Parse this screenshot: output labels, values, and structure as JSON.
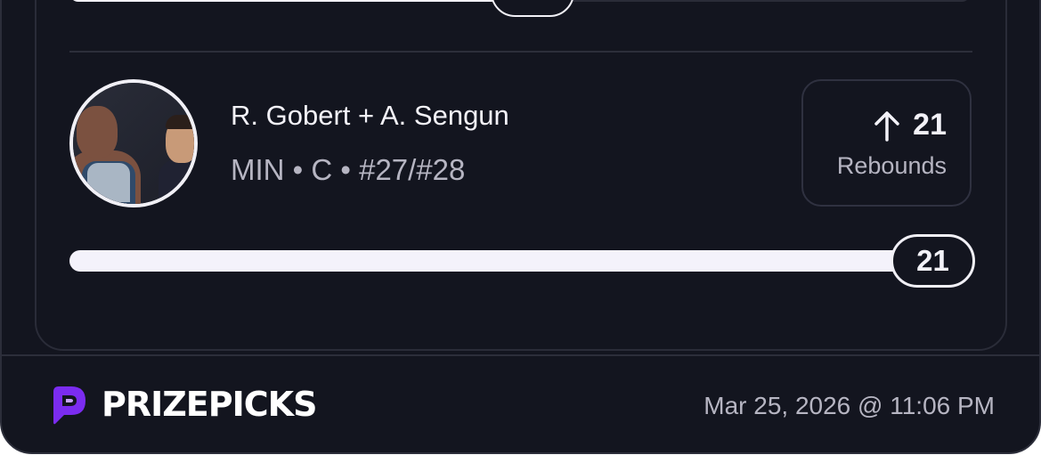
{
  "player": {
    "name": "R. Gobert + A. Sengun",
    "meta": "MIN • C • #27/#28"
  },
  "projection": {
    "direction_icon": "arrow-up-icon",
    "value": "21",
    "stat": "Rebounds"
  },
  "progress": {
    "current": "21",
    "fraction": 0.93
  },
  "footer": {
    "brand": "PRIZEPICKS",
    "timestamp": "Mar 25, 2026 @ 11:06 PM"
  },
  "colors": {
    "background": "#13151f",
    "brand_purple": "#7b2cf0",
    "text_primary": "#f3f2f8",
    "text_secondary": "#b6b5c2"
  }
}
